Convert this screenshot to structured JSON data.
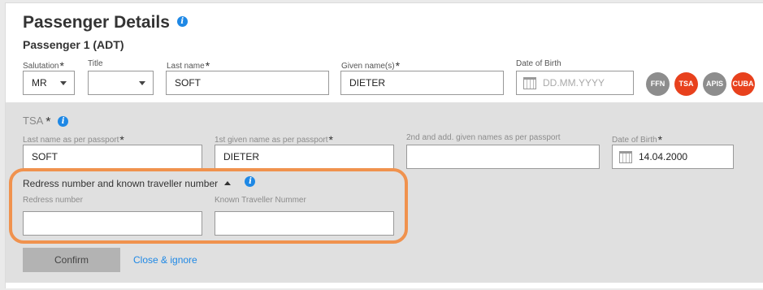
{
  "header": {
    "title": "Passenger Details",
    "info_icon": "i",
    "subtitle": "Passenger 1 (ADT)"
  },
  "passenger_form": {
    "salutation_label": "Salutation",
    "salutation_value": "MR",
    "title_label": "Title",
    "title_value": "",
    "last_name_label": "Last name",
    "last_name_value": "SOFT",
    "given_names_label": "Given name(s)",
    "given_names_value": "DIETER",
    "dob_label": "Date of Birth",
    "dob_placeholder": "DD.MM.YYYY",
    "required_marker": "*"
  },
  "badges": [
    {
      "label": "FFN",
      "color": "#8d8d8d"
    },
    {
      "label": "TSA",
      "color": "#e8411d"
    },
    {
      "label": "APIS",
      "color": "#8d8d8d"
    },
    {
      "label": "CUBA",
      "color": "#e8411d"
    }
  ],
  "tsa": {
    "section_label": "TSA",
    "last_name_label": "Last name as per passport",
    "last_name_value": "SOFT",
    "first_given_label": "1st given name as per passport",
    "first_given_value": "DIETER",
    "additional_names_label": "2nd and add. given names as per passport",
    "additional_names_value": "",
    "dob_label": "Date of Birth",
    "dob_value": "14.04.2000",
    "redress_heading": "Redress number and known traveller number",
    "redress_label": "Redress number",
    "redress_value": "",
    "ktn_label": "Known Traveller Nummer",
    "ktn_value": ""
  },
  "actions": {
    "confirm_label": "Confirm",
    "close_label": "Close & ignore"
  },
  "colors": {
    "accent_blue": "#1e88e5",
    "highlight_orange": "#f0924e",
    "badge_red": "#e8411d",
    "badge_grey": "#8d8d8d"
  }
}
